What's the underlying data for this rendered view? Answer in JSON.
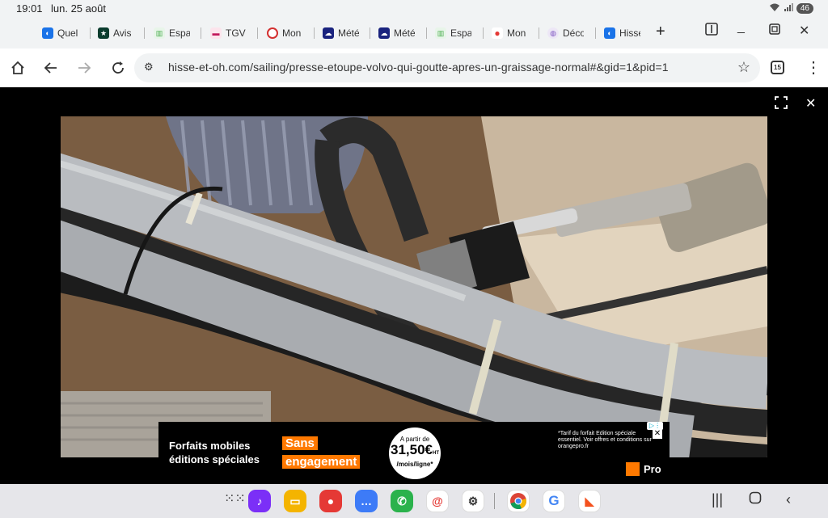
{
  "status": {
    "time": "19:01",
    "date": "lun. 25 août",
    "battery": "46"
  },
  "tabs": [
    {
      "label": "Quel",
      "icon": "hisse-icon",
      "color": "#1a73e8"
    },
    {
      "label": "Avis",
      "icon": "star-icon",
      "color": "#0b3d2e"
    },
    {
      "label": "Espa",
      "icon": "bars-icon",
      "color": "#4caf50"
    },
    {
      "label": "TGV",
      "icon": "train-icon",
      "color": "#c2185b"
    },
    {
      "label": "Mon",
      "icon": "circle-icon",
      "color": "#d32f2f"
    },
    {
      "label": "Météo",
      "icon": "weather-icon",
      "color": "#1a237e"
    },
    {
      "label": "Météo",
      "icon": "weather-icon",
      "color": "#1a237e"
    },
    {
      "label": "Espa",
      "icon": "bars-icon",
      "color": "#4caf50"
    },
    {
      "label": "Mon",
      "icon": "dot-icon",
      "color": "#e53935"
    },
    {
      "label": "Déco",
      "icon": "globe-icon",
      "color": "#7e57c2"
    },
    {
      "label": "Hisse",
      "icon": "hisse-icon",
      "color": "#1a73e8"
    }
  ],
  "omnibox": {
    "url": "hisse-et-oh.com/sailing/presse-etoupe-volvo-qui-goutte-apres-un-graissage-normal#&gid=1&pid=1"
  },
  "tab_count": "15",
  "ad": {
    "line1": "Forfaits mobiles",
    "line2": "éditions spéciales",
    "pill1": "Sans",
    "pill2": "engagement",
    "badge_top": "A partir de",
    "badge_price": "31,50€",
    "badge_sup": "HT",
    "badge_unit": "/mois/ligne*",
    "fine_print": "*Tarif du forfait Edition spéciale essentiel. Voir offres et conditions sur orangepro.fr",
    "brand": "Pro",
    "orange": "#ff7900"
  },
  "dock": [
    {
      "name": "music-app-icon",
      "color": "#7b2ff7",
      "glyph": "♪"
    },
    {
      "name": "files-app-icon",
      "color": "#f4b400",
      "glyph": "▭"
    },
    {
      "name": "contacts-app-icon",
      "color": "#e53935",
      "glyph": "●"
    },
    {
      "name": "messages-app-icon",
      "color": "#3d7bf7",
      "glyph": "…"
    },
    {
      "name": "phone-app-icon",
      "color": "#2bb24c",
      "glyph": "✆"
    },
    {
      "name": "email-app-icon",
      "color": "#ffffff",
      "glyph": "@"
    },
    {
      "name": "settings-app-icon",
      "color": "#ffffff",
      "glyph": "⚙"
    },
    {
      "name": "chrome-app-icon",
      "color": "#ffffff",
      "glyph": "◉"
    },
    {
      "name": "google-app-icon",
      "color": "#ffffff",
      "glyph": "G"
    },
    {
      "name": "notes-app-icon",
      "color": "#ffffff",
      "glyph": "◣"
    }
  ]
}
